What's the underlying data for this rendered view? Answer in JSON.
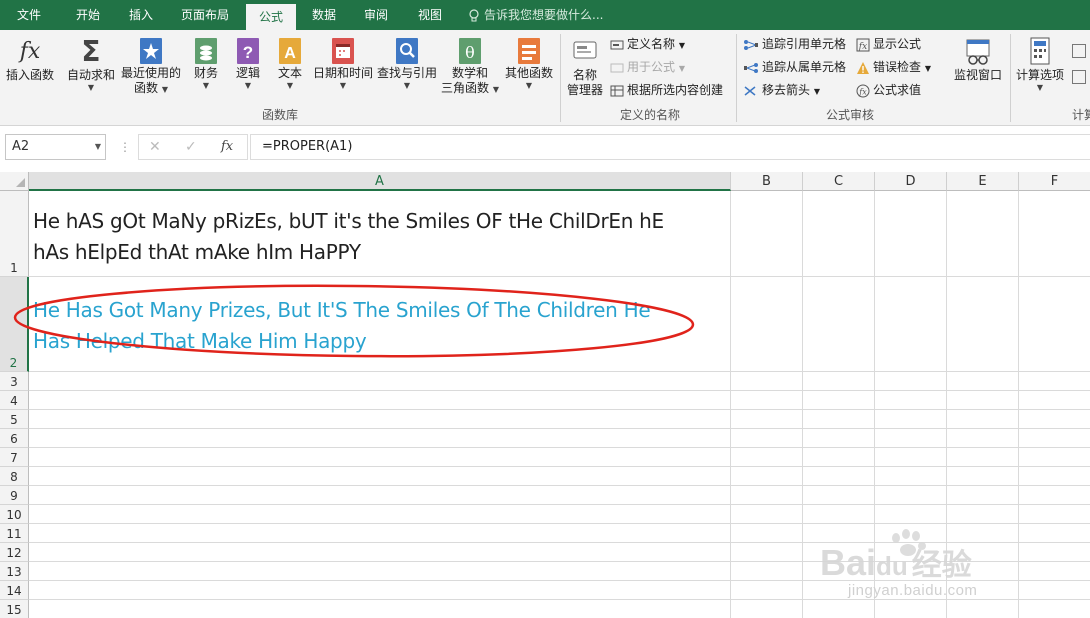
{
  "menu": {
    "tabs": [
      "文件",
      "开始",
      "插入",
      "页面布局",
      "公式",
      "数据",
      "审阅",
      "视图"
    ],
    "active_tab": "公式",
    "tell_me": "告诉我您想要做什么..."
  },
  "ribbon": {
    "insert_function": "插入函数",
    "autosum": "自动求和",
    "recent": "最近使用的",
    "recent2": "函数",
    "financial": "财务",
    "logical": "逻辑",
    "text": "文本",
    "datetime": "日期和时间",
    "lookup": "查找与引用",
    "math": "数学和",
    "math2": "三角函数",
    "more": "其他函数",
    "group_library": "函数库",
    "name_manager": "名称",
    "name_manager2": "管理器",
    "define_name": "定义名称",
    "use_in_formula": "用于公式",
    "create_from_selection": "根据所选内容创建",
    "group_names": "定义的名称",
    "trace_precedents": "追踪引用单元格",
    "trace_dependents": "追踪从属单元格",
    "remove_arrows": "移去箭头",
    "show_formulas": "显示公式",
    "error_checking": "错误检查",
    "evaluate_formula": "公式求值",
    "group_auditing": "公式审核",
    "watch_window": "监视窗口",
    "calc_options": "计算选项",
    "group_calc": "计算"
  },
  "formula_bar": {
    "name_box": "A2",
    "formula": "=PROPER(A1)"
  },
  "columns": [
    "A",
    "B",
    "C",
    "D",
    "E",
    "F"
  ],
  "rows": [
    "1",
    "2",
    "3",
    "4",
    "5",
    "6",
    "7",
    "8",
    "9",
    "10",
    "11",
    "12",
    "13",
    "14",
    "15"
  ],
  "cells": {
    "A1_line1": "He hAS gOt MaNy pRizEs, bUT it's the Smiles OF tHe ChilDrEn hE",
    "A1_line2": "hAs hElpEd thAt mAke hIm HaPPY",
    "A2_line1": "He Has Got Many Prizes, But It'S The Smiles Of The Children He",
    "A2_line2": "Has Helped That Make Him Happy"
  },
  "watermark": {
    "brand": "Bai",
    "brand2": "du",
    "brand_cn": "经验",
    "url": "jingyan.baidu.com"
  },
  "colors": {
    "excel_green": "#217346",
    "result_text": "#29a3cf",
    "annotation_ellipse": "#e0231b"
  }
}
